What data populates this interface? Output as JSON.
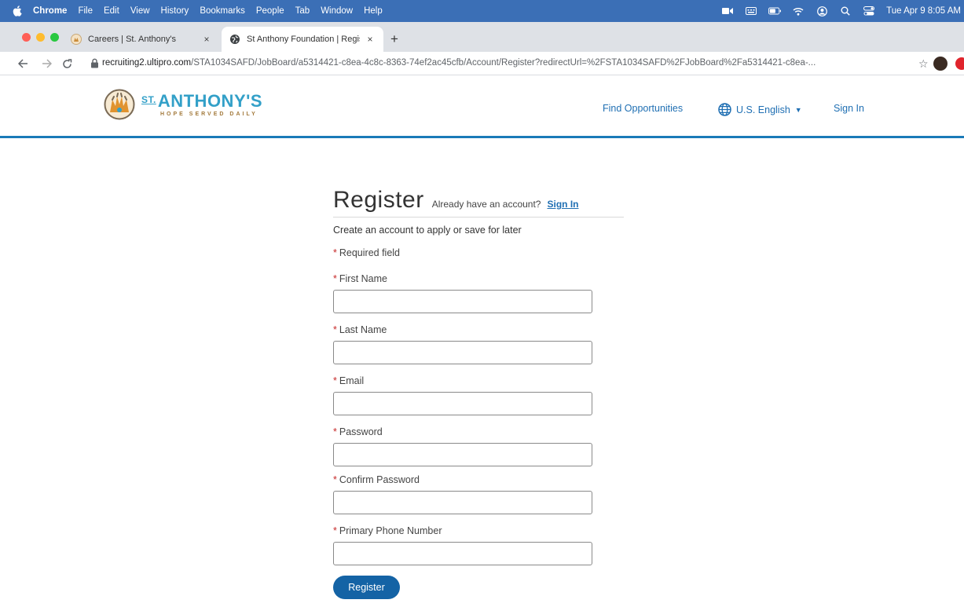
{
  "menubar": {
    "app": "Chrome",
    "items": [
      "File",
      "Edit",
      "View",
      "History",
      "Bookmarks",
      "People",
      "Tab",
      "Window",
      "Help"
    ],
    "clock": "Tue Apr 9  8:05 AM"
  },
  "tabs": [
    {
      "label": "Careers | St. Anthony's",
      "close": "×"
    },
    {
      "label": "St Anthony Foundation | Regist",
      "close": "×"
    }
  ],
  "newtab": "+",
  "address": {
    "host": "recruiting2.ultipro.com",
    "path": "/STA1034SAFD/JobBoard/a5314421-c8ea-4c8c-8363-74ef2ac45cfb/Account/Register?redirectUrl=%2FSTA1034SAFD%2FJobBoard%2Fa5314421-c8ea-..."
  },
  "header": {
    "logo_st": "ST.",
    "logo_name": "ANTHONY'S",
    "logo_tagline": "HOPE SERVED DAILY",
    "nav_find": "Find Opportunities",
    "nav_lang": "U.S. English",
    "nav_signin": "Sign In"
  },
  "form": {
    "title": "Register",
    "already": "Already have an account?",
    "already_link": "Sign In",
    "subtitle": "Create an account to apply or save for later",
    "required_note": "Required field",
    "asterisk": "*",
    "fields": [
      {
        "label": "First Name",
        "value": ""
      },
      {
        "label": "Last Name",
        "value": ""
      },
      {
        "label": "Email",
        "value": ""
      },
      {
        "label": "Password",
        "value": ""
      },
      {
        "label": "Confirm Password",
        "value": ""
      },
      {
        "label": "Primary Phone Number",
        "value": ""
      }
    ],
    "submit": "Register"
  },
  "colors": {
    "menubar": "#3b6fb6",
    "brand_blue": "#1f6fb3",
    "button": "#1463a5",
    "logo": "#33a0c8",
    "required": "#c62828"
  }
}
